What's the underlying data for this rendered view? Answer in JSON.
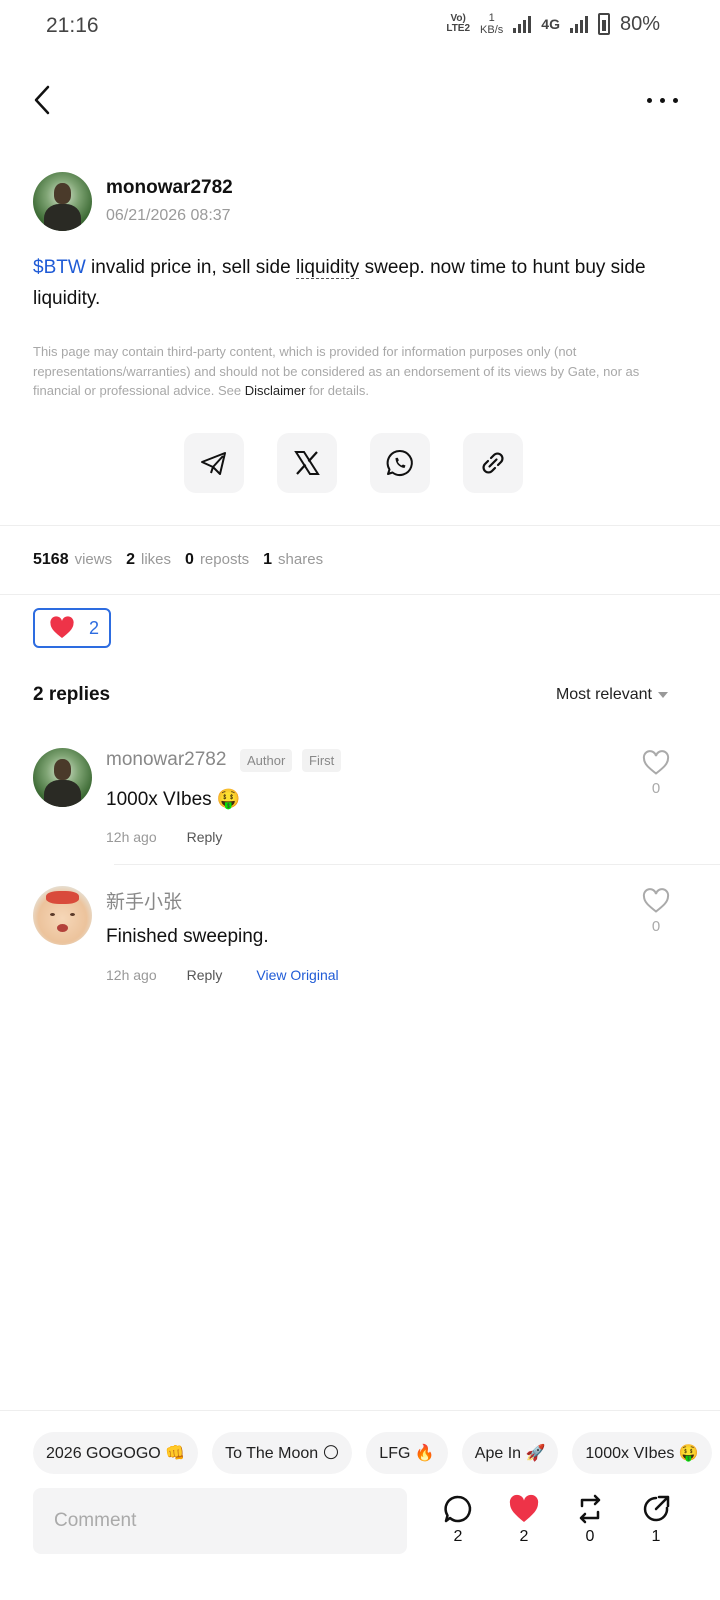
{
  "status_bar": {
    "time": "21:16",
    "volte_top": "Vo)",
    "volte_bottom": "LTE2",
    "speed_value": "1",
    "speed_unit": "KB/s",
    "network": "4G",
    "battery": "80%"
  },
  "post": {
    "author": "monowar2782",
    "date": "06/21/2026 08:37",
    "ticker": "$BTW",
    "text_part1": " invalid price in, sell side ",
    "text_underlined": "liquidity",
    "text_part2": " sweep. now time to hunt buy side liquidity.",
    "disclaimer_part1": "This page may contain third-party content, which is provided for information purposes only (not representations/warranties) and should not be considered as an endorsement of its views by Gate, nor as financial or professional advice. See ",
    "disclaimer_link": "Disclaimer",
    "disclaimer_part2": " for details."
  },
  "share_icons": [
    "telegram-icon",
    "x-icon",
    "whatsapp-icon",
    "link-icon"
  ],
  "stats": {
    "views": "5168",
    "views_label": "views",
    "likes": "2",
    "likes_label": "likes",
    "reposts": "0",
    "reposts_label": "reposts",
    "shares": "1",
    "shares_label": "shares"
  },
  "reaction": {
    "count": "2"
  },
  "replies_header": {
    "title": "2 replies",
    "sort": "Most relevant"
  },
  "replies": [
    {
      "name": "monowar2782",
      "badges": [
        "Author",
        "First"
      ],
      "text": "1000x VIbes 🤑",
      "time": "12h ago",
      "reply_label": "Reply",
      "likes": "0"
    },
    {
      "name": "新手小张",
      "text": "Finished sweeping.",
      "time": "12h ago",
      "reply_label": "Reply",
      "view_original": "View Original",
      "likes": "0"
    }
  ],
  "quick_replies": [
    "2026 GOGOGO 👊",
    "To The Moon 🌕",
    "LFG 🔥",
    "Ape In 🚀",
    "1000x VIbes 🤑"
  ],
  "bottom_bar": {
    "comment_placeholder": "Comment",
    "comments": "2",
    "likes": "2",
    "reposts": "0",
    "shares": "1"
  },
  "colors": {
    "accent_blue": "#1f5bd6",
    "heart_red": "#ee3348",
    "muted_text": "#9a9a9a"
  }
}
